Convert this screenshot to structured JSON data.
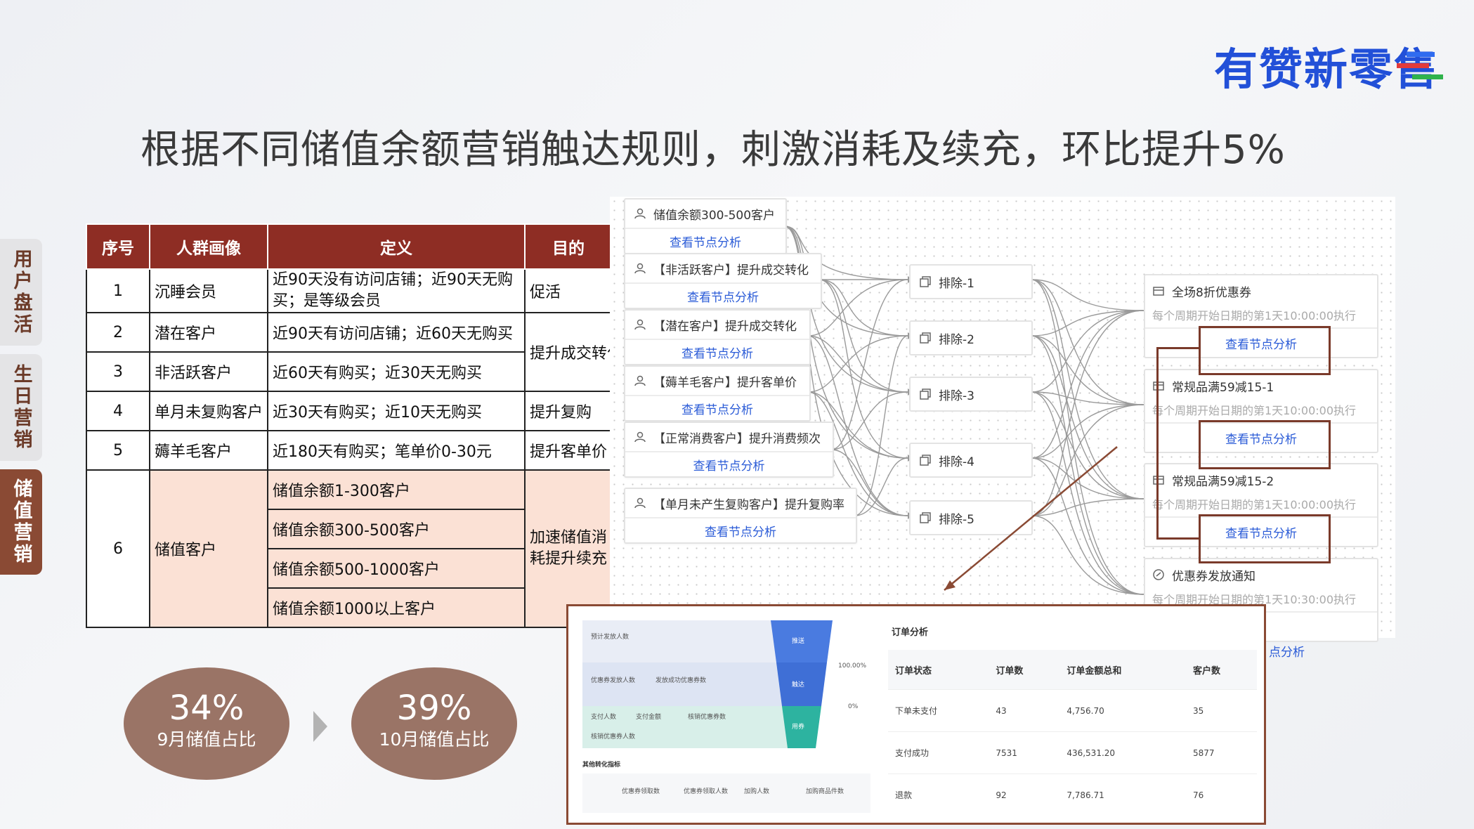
{
  "logo": "有赞新零售",
  "title": "根据不同储值余额营销触达规则，刺激消耗及续充，环比提升5%",
  "side_tabs": [
    "用户盘活",
    "生日营销",
    "储值营销"
  ],
  "active_tab": "储值营销",
  "table": {
    "headers": [
      "序号",
      "人群画像",
      "定义",
      "目的"
    ],
    "rows": [
      {
        "no": "1",
        "persona": "沉睡会员",
        "definition": "近90天没有访问店铺；近90天无购买；是等级会员",
        "purpose": "促活"
      },
      {
        "no": "2",
        "persona": "潜在客户",
        "definition": "近90天有访问店铺；近60天无购买"
      },
      {
        "no": "3",
        "persona": "非活跃客户",
        "definition": "近60天有购买；近30天无购买",
        "purpose_merged_2_3": "提升成交转化"
      },
      {
        "no": "4",
        "persona": "单月未复购客户",
        "definition": "近30天有购买；近10天无购买",
        "purpose": "提升复购"
      },
      {
        "no": "5",
        "persona": "薅羊毛客户",
        "definition": "近180天有购买；笔单价0-30元",
        "purpose": "提升客单价"
      },
      {
        "no": "6",
        "persona": "储值客户",
        "definitions": [
          "储值余额1-300客户",
          "储值余额300-500客户",
          "储值余额500-1000客户",
          "储值余额1000以上客户"
        ],
        "purpose": "加速储值消耗提升续充"
      }
    ]
  },
  "flow": {
    "segment_nodes": [
      {
        "label": "储值余额300-500客户",
        "link": "查看节点分析"
      },
      {
        "label": "【非活跃客户】提升成交转化",
        "link": "查看节点分析"
      },
      {
        "label": "【潜在客户】提升成交转化",
        "link": "查看节点分析"
      },
      {
        "label": "【薅羊毛客户】提升客单价",
        "link": "查看节点分析"
      },
      {
        "label": "【正常消费客户】提升消费频次",
        "link": "查看节点分析"
      },
      {
        "label": "【单月未产生复购客户】提升复购率",
        "link": "查看节点分析"
      }
    ],
    "exclude_nodes": [
      "排除-1",
      "排除-2",
      "排除-3",
      "排除-4",
      "排除-5"
    ],
    "action_nodes": [
      {
        "label": "全场8折优惠券",
        "schedule": "每个周期开始日期的第1天10:00:00执行",
        "link": "查看节点分析"
      },
      {
        "label": "常规品满59减15-1",
        "schedule": "每个周期开始日期的第1天10:00:00执行",
        "link": "查看节点分析"
      },
      {
        "label": "常规品满59减15-2",
        "schedule": "每个周期开始日期的第1天10:00:00执行",
        "link": "查看节点分析"
      },
      {
        "label": "优惠券发放通知",
        "schedule": "每个周期开始日期的第1天10:30:00执行",
        "link": "查看节点分析"
      }
    ]
  },
  "stats": [
    {
      "value": "34%",
      "label": "9月储值占比"
    },
    {
      "value": "39%",
      "label": "10月储值占比"
    }
  ],
  "analysis": {
    "funnel_labels": [
      "预计发放人数",
      "优惠券发放人数",
      "发放成功优惠券数",
      "支付人数",
      "支付金额",
      "核销优惠券数",
      "核销优惠券人数"
    ],
    "funnel_stages": [
      "推送",
      "触达",
      "用券"
    ],
    "funnel_pcts": [
      "100.00%",
      "0%"
    ],
    "other_title": "其他转化指标",
    "other_metrics": [
      "优惠券领取数",
      "优惠券领取人数",
      "加购人数",
      "加购商品件数"
    ],
    "order_title": "订单分析",
    "order_headers": [
      "订单状态",
      "订单数",
      "订单金额总和",
      "客户数"
    ],
    "order_rows": [
      [
        "下单未支付",
        "43",
        "4,756.70",
        "35"
      ],
      [
        "支付成功",
        "7531",
        "436,531.20",
        "5877"
      ],
      [
        "退款",
        "92",
        "7,786.71",
        "76"
      ]
    ],
    "overflow_link": "点分析"
  },
  "colors": {
    "table_header": "#8e2d24",
    "pink_cell": "#fbe1d5",
    "accent_brown": "#8a4a34",
    "link_blue": "#2a5bd7",
    "logo_blue": "#2250d8"
  }
}
